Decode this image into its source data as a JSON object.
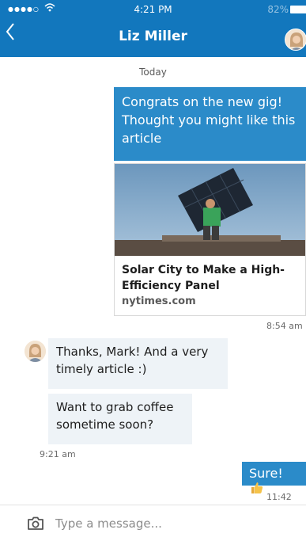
{
  "status_bar": {
    "signal": "●●●●○",
    "time": "4:21 PM",
    "battery": "82%"
  },
  "header": {
    "title": "Liz Miller",
    "back_icon": "chevron-left-icon",
    "avatar_icon": "contact-avatar"
  },
  "conversation": {
    "date_label": "Today",
    "messages": [
      {
        "from": "me",
        "text": "Congrats on the new gig! Thought you might like this article"
      },
      {
        "from": "me",
        "type": "link_card",
        "title": "Solar City to Make a High-Efficiency Panel",
        "source": "nytimes.com",
        "time": "8:54 am"
      },
      {
        "from": "them",
        "text": "Thanks, Mark! And a very timely article :)"
      },
      {
        "from": "them",
        "text": "Want to grab coffee sometime soon?",
        "time": "9:21 am"
      },
      {
        "from": "me",
        "text": "Sure!",
        "emoji": "thumbs-up-icon",
        "time": "11:42 am"
      }
    ]
  },
  "composer": {
    "placeholder": "Type a message...",
    "camera_icon": "camera-icon"
  },
  "colors": {
    "header": "#1277bd",
    "outgoing_bubble": "#2b8bc9",
    "incoming_bubble": "#eef3f7"
  }
}
